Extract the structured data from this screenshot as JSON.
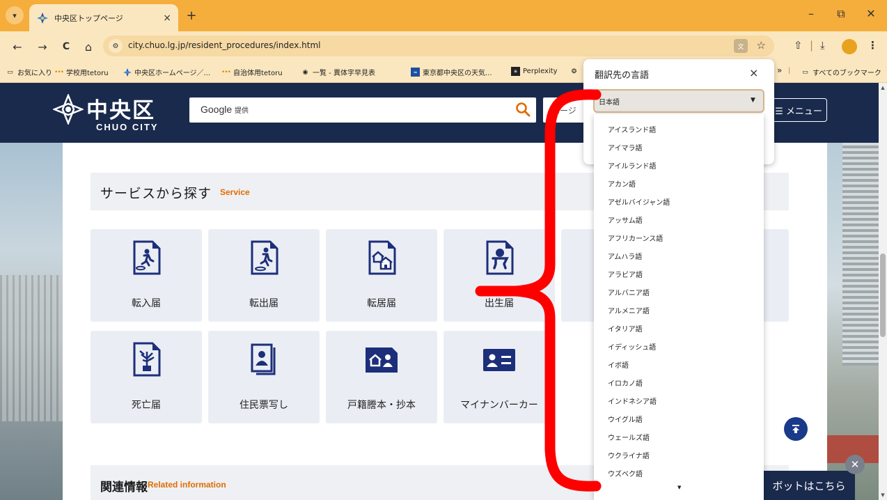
{
  "browser": {
    "tab_title": "中央区トップページ",
    "tab_close": "×",
    "new_tab": "+",
    "window_controls": [
      "–",
      "⧉",
      "✕"
    ],
    "nav": {
      "back": "←",
      "forward": "→",
      "reload": "C",
      "home": "⌂"
    },
    "url": "city.chuo.lg.jp/resident_procedures/index.html",
    "translate_icon": "文",
    "star": "☆",
    "toolbar_right": [
      "⇧",
      "|",
      "⤓",
      "⋮"
    ],
    "bookmarks": [
      "お気に入り",
      "学校用tetoru",
      "中央区ホームページ／...",
      "自治体用tetoru",
      "一覧 - 異体字早見表",
      "東京都中央区の天気...",
      "Perplexity"
    ],
    "bookmarks_overflow": "»",
    "all_bookmarks": "すべてのブックマーク"
  },
  "site": {
    "logo_jp": "中央区",
    "logo_en": "CHUO CITY",
    "search_placeholder": "Google",
    "search_provided": "提供",
    "page_search": "ページ",
    "menu_label": "☰ メニュー",
    "section_title": "サービスから探す",
    "section_title_en": "Service",
    "services": [
      {
        "label": "転入届",
        "icon": "move-in-icon"
      },
      {
        "label": "転出届",
        "icon": "move-out-icon"
      },
      {
        "label": "転居届",
        "icon": "relocation-icon"
      },
      {
        "label": "出生届",
        "icon": "birth-icon"
      },
      {
        "label": "死亡届",
        "icon": "death-icon"
      },
      {
        "label": "住民票写し",
        "icon": "resident-card-icon"
      },
      {
        "label": "戸籍謄本・抄本",
        "icon": "family-register-icon"
      },
      {
        "label": "マイナンバーカー",
        "icon": "mynumber-card-icon"
      }
    ],
    "related_title": "関連情報",
    "related_title_en": "Related information",
    "chatbot_label": "ボットはこちら",
    "chat_close": "✕",
    "scroll_top": "⤒"
  },
  "translate_bubble": {
    "title": "翻訳先の言語",
    "close": "×",
    "selected": "日本語",
    "options": [
      "アイスランド語",
      "アイマラ語",
      "アイルランド語",
      "アカン語",
      "アゼルバイジャン語",
      "アッサム語",
      "アフリカーンス語",
      "アムハラ語",
      "アラビア語",
      "アルバニア語",
      "アルメニア語",
      "イタリア語",
      "イディッシュ語",
      "イボ語",
      "イロカノ語",
      "インドネシア語",
      "ウイグル語",
      "ウェールズ語",
      "ウクライナ語",
      "ウズベク語"
    ]
  },
  "colors": {
    "titlebar": "#f5ad3c",
    "toolbar": "#fbe7bf",
    "site_header": "#1a2a4d",
    "accent_orange": "#e06c00",
    "icon_navy": "#1d2f7a",
    "annotation_red": "#ff0000"
  }
}
